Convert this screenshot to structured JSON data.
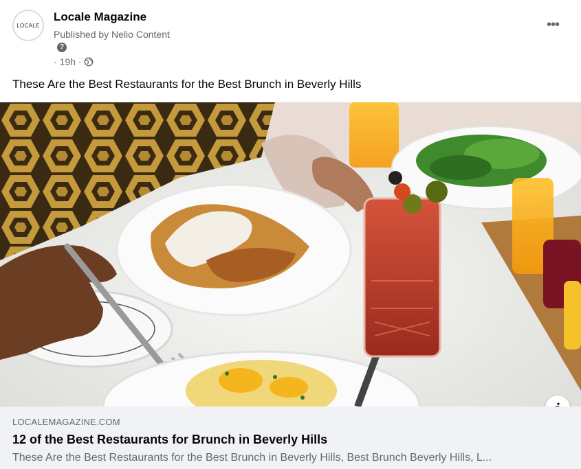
{
  "post": {
    "page_name": "Locale Magazine",
    "avatar_text": "LOCALE",
    "published_by": "Published by Nelio Content",
    "help_glyph": "?",
    "time": "· 19h ·",
    "more_glyph": "•••",
    "text": "These Are the Best Restaurants for the Best Brunch in Beverly Hills"
  },
  "icons": {
    "help": "question-icon",
    "globe": "globe-icon",
    "more": "more-icon",
    "info": "info-icon"
  },
  "link": {
    "domain": "LOCALEMAGAZINE.COM",
    "title": "12 of the Best Restaurants for Brunch in Beverly Hills",
    "description": "These Are the Best Restaurants for the Best Brunch in Beverly Hills, Best Brunch Beverly Hills, L...",
    "info_glyph": "i"
  },
  "colors": {
    "secondary_text": "#65676b",
    "link_box_bg": "#f0f2f5",
    "primary_text": "#050505"
  }
}
